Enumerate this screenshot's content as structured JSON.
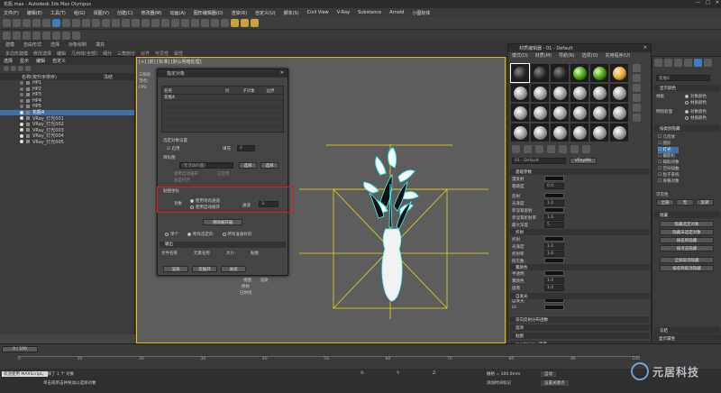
{
  "window": {
    "title": "花瓶.max - Autodesk 3ds Max Olympus"
  },
  "menu": [
    "文件(F)",
    "编辑(E)",
    "工具(T)",
    "组(G)",
    "视图(V)",
    "创建(C)",
    "修改器(M)",
    "动画(A)",
    "图形编辑器(D)",
    "渲染(R)",
    "自定义(U)",
    "脚本(S)",
    "Civil View",
    "V-Ray",
    "Substance",
    "Arnold",
    "小图标体"
  ],
  "ribbon": {
    "tabs": [
      "建模",
      "自由形式",
      "选择",
      "对象绘制",
      "填充"
    ],
    "sub": [
      "多边形建模",
      "修改选择",
      "编辑",
      "几何体(全部)",
      "细分",
      "三角剖分",
      "对齐",
      "可见性",
      "属性"
    ]
  },
  "scene_explorer": {
    "tabs": [
      "选择",
      "显示",
      "编辑",
      "自定义"
    ],
    "column": "名称(按升序排序)",
    "column2": "冻结",
    "items": [
      "HP1",
      "HP2",
      "HP3",
      "HP4",
      "HP5",
      "花瓶4",
      "VRay_灯光001",
      "VRay_灯光002",
      "VRay_灯光003",
      "VRay_灯光004",
      "VRay_灯光005"
    ],
    "selected_index": 5
  },
  "viewport": {
    "label": "[+] [前] [标准] [默认明暗处理]",
    "side": [
      "三角形",
      "顶点:",
      "FPS:"
    ]
  },
  "dialog": {
    "title": "指定对象",
    "table_headers": [
      "名称",
      "对",
      "子对象",
      "边界"
    ],
    "table_rows": [
      [
        "花瓶4",
        "",
        "",
        ""
      ]
    ],
    "group1": "选定对象设置",
    "enable": "启用",
    "padding_label": "填充",
    "padding_value": "2",
    "group2": "贴图坐标",
    "use_existing": "使用现有通道",
    "use_auto": "使用自动展开",
    "channel_label": "通道",
    "channel_value": "3",
    "clear_unwrap": "清除展开器",
    "radios_bottom": [
      "单个",
      "所有选定的",
      "所有准备好的"
    ],
    "output_header": "输出",
    "output_cols": [
      "文件名称",
      "元素名称",
      "大小",
      "贴图"
    ],
    "buttons": [
      "渲染",
      "仅展开",
      "关闭"
    ],
    "views": [
      "视图",
      "渲染"
    ],
    "frame_label": "原始",
    "enabled_label": "已烘焙",
    "target_label": "目标图",
    "target_value": "(无活动的面)",
    "target_buttons": [
      "选择",
      "选择"
    ],
    "options": [
      "使用自动展开",
      "已启用",
      "总是打开"
    ]
  },
  "material_editor": {
    "title": "材质编辑器 - 01 - Default",
    "menu": [
      "模式(D)",
      "材质(M)",
      "导航(N)",
      "选项(O)",
      "实用程序(U)"
    ],
    "material_name": "01 - Default",
    "material_type": "VRayMtl",
    "sections": [
      "基础参数",
      "漫反射",
      "反射",
      "光泽度",
      "菲涅耳反射",
      "折射",
      "半透明",
      "雾颜色",
      "自发光",
      "双向反射分布函数",
      "选项",
      "贴图",
      "mental ray 连接"
    ],
    "labels": {
      "diffuse": "漫反射",
      "roughness": "粗糙度",
      "reflect": "反射",
      "gloss": "光泽度",
      "fresnel": "菲涅耳反射",
      "fresnel_ior": "菲涅耳折射率",
      "max_depth": "最大深度",
      "refract": "折射",
      "ior": "折射率",
      "fog": "雾颜色",
      "abbe": "阿贝数",
      "translucency": "半透明",
      "self_illum": "自发光",
      "gi": "GI",
      "mult": "倍增"
    },
    "values": {
      "roughness": "0.0",
      "gloss": "1.0",
      "ior": "1.6",
      "max_depth": "5",
      "refl_ior": "1.6",
      "fog_mult": "1.0",
      "exit": "1.0"
    },
    "sphere_count": 24
  },
  "command_panel": {
    "name_field": "花瓶4",
    "sections": [
      "显示颜色",
      "按类别隐藏",
      "隐藏",
      "冻结",
      "显示属性",
      "链接显示"
    ],
    "label_wireframe": "线框",
    "label_shaded": "明暗处理",
    "radio_obj": "对象颜色",
    "radio_mat": "材质颜色",
    "categories": [
      "几何体",
      "图形",
      "灯光",
      "摄影机",
      "辅助对象",
      "空间扭曲",
      "粒子系统",
      "骨骼对象"
    ],
    "filter_label": "可见性",
    "buttons": [
      "全部",
      "无",
      "反转",
      "隐藏选定对象",
      "隐藏未选定对象",
      "按名称隐藏",
      "按点击隐藏",
      "全部取消隐藏",
      "按名称取消隐藏"
    ]
  },
  "timeline": {
    "frame": "0 / 100",
    "ticks": [
      "0",
      "10",
      "20",
      "30",
      "40",
      "50",
      "60",
      "70",
      "80",
      "90",
      "100"
    ]
  },
  "status": {
    "msg1": "选择了 1 个 对象",
    "msg2": "单击或单击并拖动以选择对象",
    "welcome": "欢迎使用 MAXScript。",
    "x_label": "X:",
    "y_label": "Y:",
    "z_label": "Z:",
    "grid": "栅格 = 100.0mm",
    "add_time": "添加时间标记",
    "auto_key": "自动",
    "set_key": "设置关键点"
  },
  "watermark": "元居科技"
}
